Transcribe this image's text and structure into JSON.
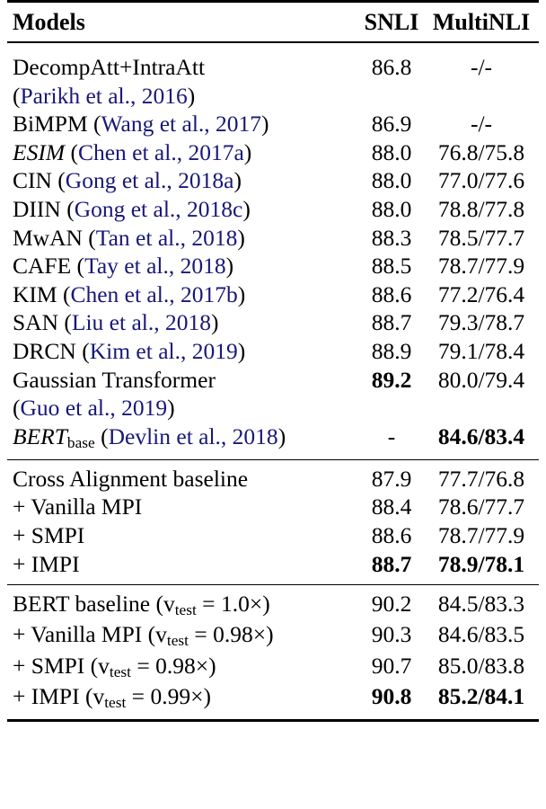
{
  "table": {
    "columns": [
      "Models",
      "SNLI",
      "MultiNLI"
    ],
    "sections": [
      {
        "name": "published-baselines",
        "rows": [
          {
            "model_parts": [
              {
                "text": "DecompAtt+IntraAtt",
                "style": "plain"
              }
            ],
            "continuation_parts": [
              {
                "text": "(",
                "style": "plain"
              },
              {
                "text": "Parikh et al., 2016",
                "style": "cite"
              },
              {
                "text": ")",
                "style": "plain"
              }
            ],
            "snli": "86.8",
            "multinli": "-/-",
            "snli_bold": false,
            "multinli_bold": false
          },
          {
            "model_parts": [
              {
                "text": "BiMPM (",
                "style": "plain"
              },
              {
                "text": "Wang et al., 2017",
                "style": "cite"
              },
              {
                "text": ")",
                "style": "plain"
              }
            ],
            "snli": "86.9",
            "multinli": "-/-",
            "snli_bold": false,
            "multinli_bold": false
          },
          {
            "model_parts": [
              {
                "text": "ESIM",
                "style": "italic"
              },
              {
                "text": " (",
                "style": "plain"
              },
              {
                "text": "Chen et al., 2017a",
                "style": "cite"
              },
              {
                "text": ")",
                "style": "plain"
              }
            ],
            "snli": "88.0",
            "multinli": "76.8/75.8",
            "snli_bold": false,
            "multinli_bold": false
          },
          {
            "model_parts": [
              {
                "text": "CIN (",
                "style": "plain"
              },
              {
                "text": "Gong et al., 2018a",
                "style": "cite"
              },
              {
                "text": ")",
                "style": "plain"
              }
            ],
            "snli": "88.0",
            "multinli": "77.0/77.6",
            "snli_bold": false,
            "multinli_bold": false
          },
          {
            "model_parts": [
              {
                "text": "DIIN (",
                "style": "plain"
              },
              {
                "text": "Gong et al., 2018c",
                "style": "cite"
              },
              {
                "text": ")",
                "style": "plain"
              }
            ],
            "snli": "88.0",
            "multinli": "78.8/77.8",
            "snli_bold": false,
            "multinli_bold": false
          },
          {
            "model_parts": [
              {
                "text": "MwAN (",
                "style": "plain"
              },
              {
                "text": "Tan et al., 2018",
                "style": "cite"
              },
              {
                "text": ")",
                "style": "plain"
              }
            ],
            "snli": "88.3",
            "multinli": "78.5/77.7",
            "snli_bold": false,
            "multinli_bold": false
          },
          {
            "model_parts": [
              {
                "text": "CAFE (",
                "style": "plain"
              },
              {
                "text": "Tay et al., 2018",
                "style": "cite"
              },
              {
                "text": ")",
                "style": "plain"
              }
            ],
            "snli": "88.5",
            "multinli": "78.7/77.9",
            "snli_bold": false,
            "multinli_bold": false
          },
          {
            "model_parts": [
              {
                "text": "KIM (",
                "style": "plain"
              },
              {
                "text": "Chen et al., 2017b",
                "style": "cite"
              },
              {
                "text": ")",
                "style": "plain"
              }
            ],
            "snli": "88.6",
            "multinli": "77.2/76.4",
            "snli_bold": false,
            "multinli_bold": false
          },
          {
            "model_parts": [
              {
                "text": "SAN (",
                "style": "plain"
              },
              {
                "text": "Liu et al., 2018",
                "style": "cite"
              },
              {
                "text": ")",
                "style": "plain"
              }
            ],
            "snli": "88.7",
            "multinli": "79.3/78.7",
            "snli_bold": false,
            "multinli_bold": false
          },
          {
            "model_parts": [
              {
                "text": "DRCN (",
                "style": "plain"
              },
              {
                "text": "Kim et al., 2019",
                "style": "cite"
              },
              {
                "text": ")",
                "style": "plain"
              }
            ],
            "snli": "88.9",
            "multinli": "79.1/78.4",
            "snli_bold": false,
            "multinli_bold": false
          },
          {
            "model_parts": [
              {
                "text": "Gaussian Transformer",
                "style": "plain"
              }
            ],
            "continuation_parts": [
              {
                "text": "(",
                "style": "plain"
              },
              {
                "text": "Guo et al., 2019",
                "style": "cite"
              },
              {
                "text": ")",
                "style": "plain"
              }
            ],
            "snli": "89.2",
            "multinli": "80.0/79.4",
            "snli_bold": true,
            "multinli_bold": false
          },
          {
            "model_parts": [
              {
                "text": "BERT",
                "style": "italic"
              },
              {
                "text": "base",
                "style": "subscript"
              },
              {
                "text": " (",
                "style": "plain"
              },
              {
                "text": "Devlin et al., 2018",
                "style": "cite"
              },
              {
                "text": ")",
                "style": "plain"
              }
            ],
            "snli": "-",
            "multinli": "84.6/83.4",
            "snli_bold": false,
            "multinli_bold": true
          }
        ]
      },
      {
        "name": "cross-alignment-ablation",
        "rows": [
          {
            "model_parts": [
              {
                "text": "Cross Alignment baseline",
                "style": "plain"
              }
            ],
            "snli": "87.9",
            "multinli": "77.7/76.8",
            "snli_bold": false,
            "multinli_bold": false
          },
          {
            "model_parts": [
              {
                "text": "+ Vanilla MPI",
                "style": "plain"
              }
            ],
            "snli": "88.4",
            "multinli": "78.6/77.7",
            "snli_bold": false,
            "multinli_bold": false
          },
          {
            "model_parts": [
              {
                "text": "+ SMPI",
                "style": "plain"
              }
            ],
            "snli": "88.6",
            "multinli": "78.7/77.9",
            "snli_bold": false,
            "multinli_bold": false
          },
          {
            "model_parts": [
              {
                "text": "+ IMPI",
                "style": "plain"
              }
            ],
            "snli": "88.7",
            "multinli": "78.9/78.1",
            "snli_bold": true,
            "multinli_bold": true
          }
        ]
      },
      {
        "name": "bert-ablation",
        "rows": [
          {
            "model_parts": [
              {
                "text": "BERT baseline (",
                "style": "plain"
              },
              {
                "text": "v",
                "style": "math-var"
              },
              {
                "text": "test",
                "style": "math-sub"
              },
              {
                "text": " = ",
                "style": "math-eq"
              },
              {
                "text": "1.0",
                "style": "math-num"
              },
              {
                "text": "×",
                "style": "math-times"
              },
              {
                "text": ")",
                "style": "plain"
              }
            ],
            "snli": "90.2",
            "multinli": "84.5/83.3",
            "snli_bold": false,
            "multinli_bold": false
          },
          {
            "model_parts": [
              {
                "text": "+ Vanilla MPI (",
                "style": "plain"
              },
              {
                "text": "v",
                "style": "math-var"
              },
              {
                "text": "test",
                "style": "math-sub"
              },
              {
                "text": " = ",
                "style": "math-eq"
              },
              {
                "text": "0.98",
                "style": "math-num"
              },
              {
                "text": "×",
                "style": "math-times"
              },
              {
                "text": ")",
                "style": "plain"
              }
            ],
            "snli": "90.3",
            "multinli": "84.6/83.5",
            "snli_bold": false,
            "multinli_bold": false
          },
          {
            "model_parts": [
              {
                "text": "+ SMPI (",
                "style": "plain"
              },
              {
                "text": "v",
                "style": "math-var"
              },
              {
                "text": "test",
                "style": "math-sub"
              },
              {
                "text": " = ",
                "style": "math-eq"
              },
              {
                "text": "0.98",
                "style": "math-num"
              },
              {
                "text": "×",
                "style": "math-times"
              },
              {
                "text": ")",
                "style": "plain"
              }
            ],
            "snli": "90.7",
            "multinli": "85.0/83.8",
            "snli_bold": false,
            "multinli_bold": false
          },
          {
            "model_parts": [
              {
                "text": "+ IMPI (",
                "style": "plain"
              },
              {
                "text": "v",
                "style": "math-var"
              },
              {
                "text": "test",
                "style": "math-sub"
              },
              {
                "text": " = ",
                "style": "math-eq"
              },
              {
                "text": "0.99",
                "style": "math-num"
              },
              {
                "text": "×",
                "style": "math-times"
              },
              {
                "text": ")",
                "style": "plain"
              }
            ],
            "snli": "90.8",
            "multinli": "85.2/84.1",
            "snli_bold": true,
            "multinli_bold": true
          }
        ]
      }
    ]
  },
  "colors": {
    "citation": "#181878",
    "text": "#000000",
    "rule": "#000000"
  }
}
